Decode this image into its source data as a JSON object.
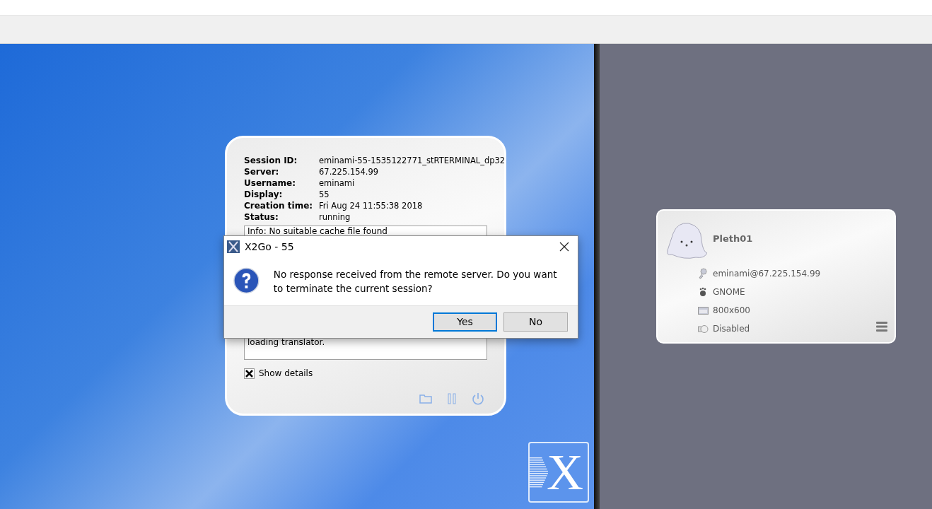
{
  "session_panel": {
    "fields": [
      {
        "label": "Session ID:",
        "value": "eminami-55-1535122771_stRTERMINAL_dp32"
      },
      {
        "label": "Server:",
        "value": "67.225.154.99"
      },
      {
        "label": "Username:",
        "value": "eminami"
      },
      {
        "label": "Display:",
        "value": "55"
      },
      {
        "label": "Creation time:",
        "value": "Fri Aug 24 11:55:38 2018"
      },
      {
        "label": "Status:",
        "value": "running"
      }
    ],
    "log_top": "Info: No suitable cache file found",
    "log_bottom": "loading translator.",
    "show_details": {
      "label": "Show details",
      "checked": true
    }
  },
  "dialog": {
    "title": "X2Go - 55",
    "message": "No response received from the remote server. Do you want to terminate the current session?",
    "buttons": [
      {
        "label": "Yes",
        "selected": true
      },
      {
        "label": "No",
        "selected": false
      }
    ]
  },
  "logo": {
    "letter": "X"
  },
  "session_card": {
    "name": "Pleth01",
    "rows": [
      {
        "kind": "login",
        "text": "eminami@67.225.154.99"
      },
      {
        "kind": "desktop",
        "text": "GNOME"
      },
      {
        "kind": "resolution",
        "text": "800x600"
      },
      {
        "kind": "sound",
        "text": "Disabled"
      }
    ]
  }
}
